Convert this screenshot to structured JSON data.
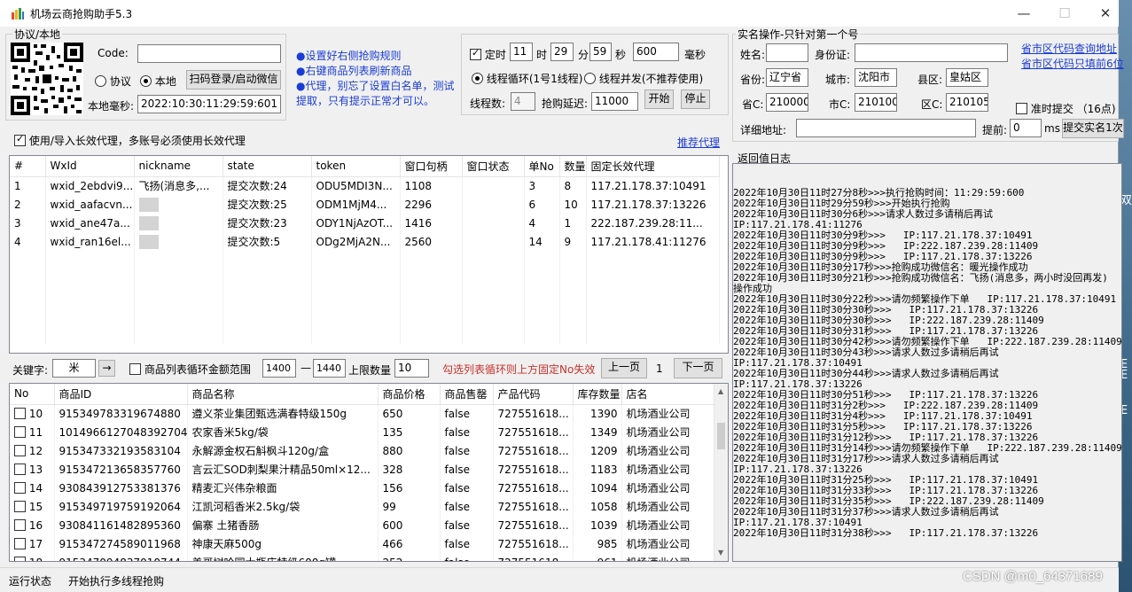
{
  "window": {
    "title": "机场云商抢购助手5.3",
    "controls": [
      "—",
      "☐",
      "✕"
    ]
  },
  "desktop": {
    "side_text": [
      "双",
      "E",
      "E",
      "E"
    ]
  },
  "protocol": {
    "group_title": "协议/本地",
    "code_label": "Code:",
    "code_value": "",
    "radio_protocol": "协议",
    "radio_local": "本地",
    "scan_button": "扫码登录/启动微信",
    "local_ms_label": "本地毫秒:",
    "local_ms_value": "2022:10:30:11:29:59:601"
  },
  "tips": [
    "●设置好右侧抢购规则",
    "●右键商品列表刷新商品",
    "●代理，别忘了设置白名单，测试提取，只有提示正常才可以。"
  ],
  "timer": {
    "timed_label": "定时",
    "hour": "11",
    "hour_label": "时",
    "minute": "29",
    "minute_label": "分",
    "second": "59",
    "second_label": "秒",
    "ms": "600",
    "ms_label": "毫秒",
    "mode_loop": "线程循环(1号1线程)",
    "mode_parallel": "线程并发(不推荐使用)",
    "threads_label": "线程数:",
    "threads_value": "4",
    "delay_label": "抢购延迟:",
    "delay_value": "11000",
    "start_button": "开始",
    "stop_button": "停止"
  },
  "realname": {
    "group_title": "实名操作-只针对第一个号",
    "name_label": "姓名:",
    "name_value": "",
    "id_label": "身份证:",
    "id_value": "",
    "query_link": "省市区代码查询地址",
    "fill_link": "省市区代码只填前6位",
    "province_label": "省份:",
    "province_value": "辽宁省",
    "city_label": "城市:",
    "city_value": "沈阳市",
    "county_label": "县区:",
    "county_value": "皇姑区",
    "prov_code_label": "省C:",
    "prov_code_value": "210000",
    "city_code_label": "市C:",
    "city_code_value": "210100",
    "area_code_label": "区C:",
    "area_code_value": "210105",
    "ontime_label": "准时提交 （16点)",
    "address_label": "详细地址:",
    "address_value": "",
    "advance_label": "提前:",
    "advance_value": "0",
    "advance_unit": "ms",
    "submit_button": "提交实名1次"
  },
  "proxy": {
    "use_label": "使用/导入长效代理，多账号必须使用长效代理",
    "recommend_link": "推荐代理"
  },
  "accounts": {
    "columns": [
      "#",
      "WxId",
      "nickname",
      "state",
      "token",
      "窗口句柄",
      "窗口状态",
      "单No",
      "数量",
      "固定长效代理"
    ],
    "rows": [
      [
        "1",
        "wxid_2ebdvi9...",
        "飞扬(消息多,...",
        "提交次数:24",
        "ODU5MDI3N...",
        "1108",
        "",
        "3",
        "8",
        "117.21.178.37:10491"
      ],
      [
        "2",
        "wxid_aafacvn...",
        "",
        "提交次数:25",
        "ODM1MjM4...",
        "2296",
        "",
        "6",
        "10",
        "117.21.178.37:13226"
      ],
      [
        "3",
        "wxid_ane47a...",
        "",
        "提交次数:23",
        "ODY1NjAzOT...",
        "1416",
        "",
        "4",
        "1",
        "222.187.239.28:11..."
      ],
      [
        "4",
        "wxid_ran16el...",
        "",
        "提交次数:5",
        "ODg2MjA2N...",
        "2560",
        "",
        "14",
        "9",
        "117.21.178.41:11276"
      ]
    ]
  },
  "filter": {
    "keyword_label": "关键字:",
    "keyword_value": "米",
    "go_button": "→",
    "loop_label": "商品列表循环金额范围",
    "min_value": "1400",
    "dash": "—",
    "max_value": "1440",
    "limit_label": "上限数量",
    "limit_value": "10",
    "warning": "勾选列表循环则上方固定No失效",
    "prev_button": "上一页",
    "page": "1",
    "next_button": "下一页"
  },
  "products": {
    "columns": [
      "No",
      "商品ID",
      "商品名称",
      "商品价格",
      "商品售罄",
      "产品代码",
      "库存数量",
      "店名"
    ],
    "rows": [
      [
        "10",
        "915349783319674880",
        "遵义茶业集团甄选满春特级150g",
        "650",
        "false",
        "727551618...",
        "1390",
        "机场酒业公司"
      ],
      [
        "11",
        "1014966127048392704",
        "农家香米5kg/袋",
        "135",
        "false",
        "727551618...",
        "1349",
        "机场酒业公司"
      ],
      [
        "12",
        "915347332193583104",
        "永解源金权石斛枫斗120g/盒",
        "880",
        "false",
        "727551618...",
        "1209",
        "机场酒业公司"
      ],
      [
        "13",
        "915347213658357760",
        "言云汇SOD刺梨果汁精品50ml×12...",
        "328",
        "false",
        "727551618...",
        "1183",
        "机场酒业公司"
      ],
      [
        "14",
        "930843912753381376",
        "精麦汇兴伟杂粮面",
        "156",
        "false",
        "727551618...",
        "1094",
        "机场酒业公司"
      ],
      [
        "15",
        "915349719759192064",
        "江凯河稻香米2.5kg/袋",
        "99",
        "false",
        "727551618...",
        "1058",
        "机场酒业公司"
      ],
      [
        "16",
        "930841161482895360",
        "偏寨 土猪香肠",
        "600",
        "false",
        "727551618...",
        "1039",
        "机场酒业公司"
      ],
      [
        "17",
        "915347274589011968",
        "神康天麻500g",
        "466",
        "false",
        "727551618...",
        "985",
        "机场酒业公司"
      ],
      [
        "18",
        "915347094837010744",
        "美哥树哈园大瓶店特级600g罐",
        "252",
        "false",
        "727551618...",
        "961",
        "机场酒业公司"
      ]
    ]
  },
  "log": {
    "title": "返回值日志",
    "lines": [
      "2022年10月30日11时27分8秒>>>执行抢购时间：11:29:59:600",
      "2022年10月30日11时29分59秒>>>开始执行抢购",
      "2022年10月30日11时30分6秒>>>请求人数过多请稍后再试",
      "IP:117.21.178.41:11276",
      "2022年10月30日11时30分9秒>>>   IP:117.21.178.37:10491",
      "2022年10月30日11时30分9秒>>>   IP:222.187.239.28:11409",
      "2022年10月30日11时30分9秒>>>   IP:117.21.178.37:13226",
      "2022年10月30日11时30分17秒>>>抢购成功微信名：暖光操作成功",
      "2022年10月30日11时30分21秒>>>抢购成功微信名：飞扬(消息多，两小时没回再发)",
      "操作成功",
      "2022年10月30日11时30分22秒>>>请勿频繁操作下单   IP:117.21.178.37:10491",
      "2022年10月30日11时30分30秒>>>   IP:117.21.178.37:13226",
      "2022年10月30日11时30分30秒>>>   IP:222.187.239.28:11409",
      "2022年10月30日11时30分31秒>>>   IP:117.21.178.37:13226",
      "2022年10月30日11时30分42秒>>>请勿频繁操作下单   IP:222.187.239.28:11409",
      "2022年10月30日11时30分43秒>>>请求人数过多请稍后再试",
      "IP:117.21.178.37:10491",
      "2022年10月30日11时30分44秒>>>请求人数过多请稍后再试",
      "IP:117.21.178.37:13226",
      "2022年10月30日11时30分51秒>>>   IP:117.21.178.37:13226",
      "2022年10月30日11时31分2秒>>>   IP:222.187.239.28:11409",
      "2022年10月30日11时31分4秒>>>   IP:117.21.178.37:10491",
      "2022年10月30日11时31分5秒>>>   IP:117.21.178.37:13226",
      "2022年10月30日11时31分12秒>>>   IP:117.21.178.37:13226",
      "2022年10月30日11时31分14秒>>>请勿频繁操作下单   IP:222.187.239.28:11409",
      "2022年10月30日11时31分17秒>>>请求人数过多请稍后再试",
      "IP:117.21.178.37:13226",
      "2022年10月30日11时31分25秒>>>   IP:117.21.178.37:10491",
      "2022年10月30日11时31分33秒>>>   IP:117.21.178.37:13226",
      "2022年10月30日11时31分35秒>>>   IP:222.187.239.28:11409",
      "2022年10月30日11时31分37秒>>>请求人数过多请稍后再试",
      "IP:117.21.178.37:10491",
      "2022年10月30日11时31分38秒>>>   IP:117.21.178.37:13226"
    ]
  },
  "status": {
    "label": "运行状态",
    "text": "开始执行多线程抢购"
  },
  "watermark": "CSDN @m0_64371689"
}
